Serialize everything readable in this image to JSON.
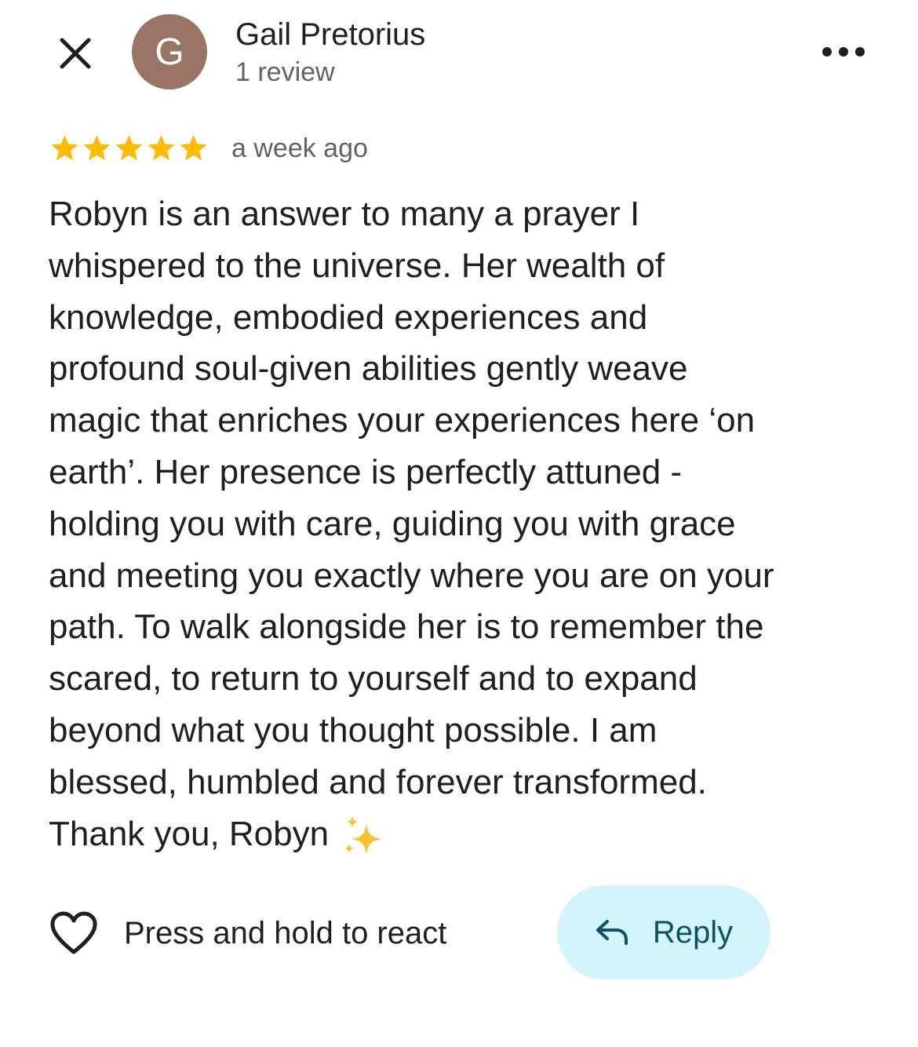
{
  "header": {
    "close_icon": "close-icon",
    "avatar_initial": "G",
    "avatar_color": "#9a7566",
    "reviewer_name": "Gail Pretorius",
    "review_count": "1 review",
    "more_icon": "more-horizontal-icon"
  },
  "review": {
    "rating": 5,
    "max_rating": 5,
    "star_color": "#fbbc04",
    "time_ago": "a week ago",
    "text": "Robyn is an answer to many a prayer I\nwhispered to the universe. Her wealth of\nknowledge, embodied experiences and\nprofound soul-given abilities gently weave\nmagic that enriches your experiences here ‘on\nearth’. Her presence is perfectly attuned -\nholding you with care, guiding you with grace\nand meeting you exactly where you are on your\npath. To walk alongside her is to remember the\nscared, to return to yourself and to expand\nbeyond what you thought possible. I am\nblessed, humbled and forever transformed.\nThank you, Robyn",
    "emoji": "sparkles-emoji"
  },
  "actions": {
    "react_icon": "heart-outline-icon",
    "react_label": "Press and hold to react",
    "reply_icon": "reply-arrow-icon",
    "reply_label": "Reply",
    "reply_bg_color": "#d3f4fb",
    "reply_text_color": "#0b5563"
  }
}
